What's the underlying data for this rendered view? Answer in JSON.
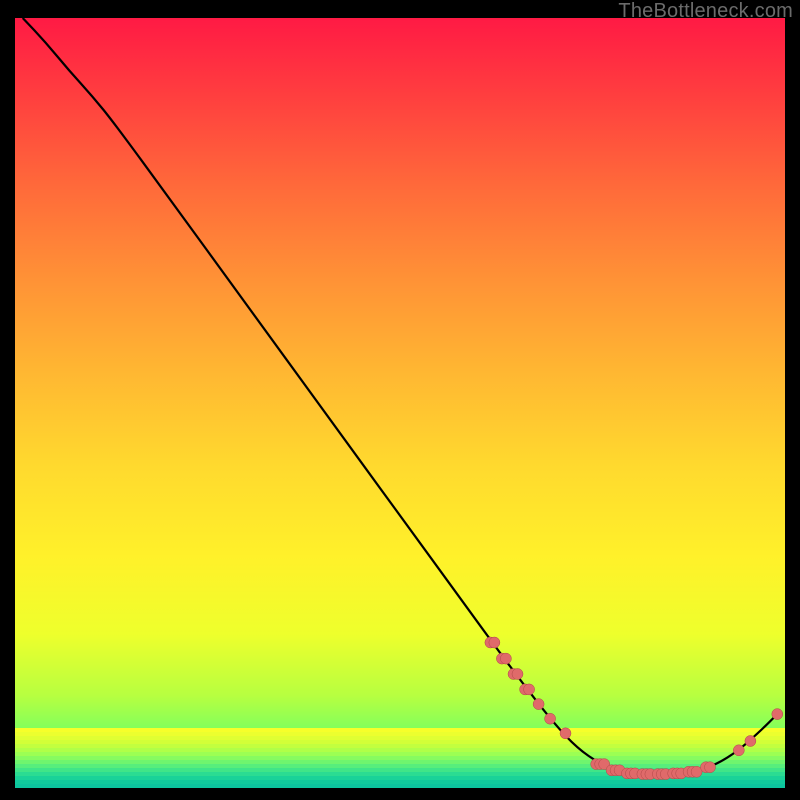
{
  "watermark": "TheBottleneck.com",
  "colors": {
    "curve": "#000000",
    "dot": "#e06a6a",
    "dot_stroke": "#b04848"
  },
  "chart_data": {
    "type": "line",
    "title": "",
    "xlabel": "",
    "ylabel": "",
    "xlim": [
      0,
      100
    ],
    "ylim": [
      0,
      100
    ],
    "curve": [
      {
        "x": 1.0,
        "y": 100.0
      },
      {
        "x": 4.0,
        "y": 96.8
      },
      {
        "x": 7.0,
        "y": 93.2
      },
      {
        "x": 10.0,
        "y": 89.9
      },
      {
        "x": 13.0,
        "y": 86.2
      },
      {
        "x": 20.0,
        "y": 76.6
      },
      {
        "x": 30.0,
        "y": 62.9
      },
      {
        "x": 40.0,
        "y": 49.1
      },
      {
        "x": 50.0,
        "y": 35.4
      },
      {
        "x": 58.0,
        "y": 24.4
      },
      {
        "x": 62.0,
        "y": 18.9
      },
      {
        "x": 66.0,
        "y": 13.5
      },
      {
        "x": 70.0,
        "y": 8.4
      },
      {
        "x": 73.0,
        "y": 5.2
      },
      {
        "x": 76.0,
        "y": 3.1
      },
      {
        "x": 79.0,
        "y": 2.1
      },
      {
        "x": 82.0,
        "y": 1.8
      },
      {
        "x": 85.0,
        "y": 1.8
      },
      {
        "x": 88.0,
        "y": 2.1
      },
      {
        "x": 91.0,
        "y": 3.0
      },
      {
        "x": 94.0,
        "y": 4.9
      },
      {
        "x": 97.0,
        "y": 7.6
      },
      {
        "x": 99.0,
        "y": 9.6
      }
    ],
    "dot_clusters": [
      {
        "x": 62.0,
        "y": 18.9,
        "n": 2
      },
      {
        "x": 63.5,
        "y": 16.8,
        "n": 2
      },
      {
        "x": 65.0,
        "y": 14.8,
        "n": 2
      },
      {
        "x": 66.5,
        "y": 12.8,
        "n": 2
      },
      {
        "x": 68.0,
        "y": 10.9,
        "n": 1
      },
      {
        "x": 69.5,
        "y": 9.0,
        "n": 1
      },
      {
        "x": 71.5,
        "y": 7.1,
        "n": 1
      },
      {
        "x": 76.0,
        "y": 3.1,
        "n": 3
      },
      {
        "x": 78.0,
        "y": 2.3,
        "n": 3
      },
      {
        "x": 80.0,
        "y": 1.9,
        "n": 3
      },
      {
        "x": 82.0,
        "y": 1.8,
        "n": 3
      },
      {
        "x": 84.0,
        "y": 1.8,
        "n": 3
      },
      {
        "x": 86.0,
        "y": 1.9,
        "n": 3
      },
      {
        "x": 88.0,
        "y": 2.1,
        "n": 3
      },
      {
        "x": 90.0,
        "y": 2.7,
        "n": 2
      },
      {
        "x": 94.0,
        "y": 4.9,
        "n": 1
      },
      {
        "x": 95.5,
        "y": 6.1,
        "n": 1
      },
      {
        "x": 99.0,
        "y": 9.6,
        "n": 1
      }
    ],
    "strata_colors": [
      "#f6ff2b",
      "#ecff2f",
      "#e0ff33",
      "#d2ff38",
      "#c2ff3f",
      "#b0ff48",
      "#9cff53",
      "#86fb60",
      "#6ff56e",
      "#57ee7c",
      "#40e588",
      "#2bdc92",
      "#1ad298",
      "#10ca9c",
      "#0cc49e"
    ]
  }
}
